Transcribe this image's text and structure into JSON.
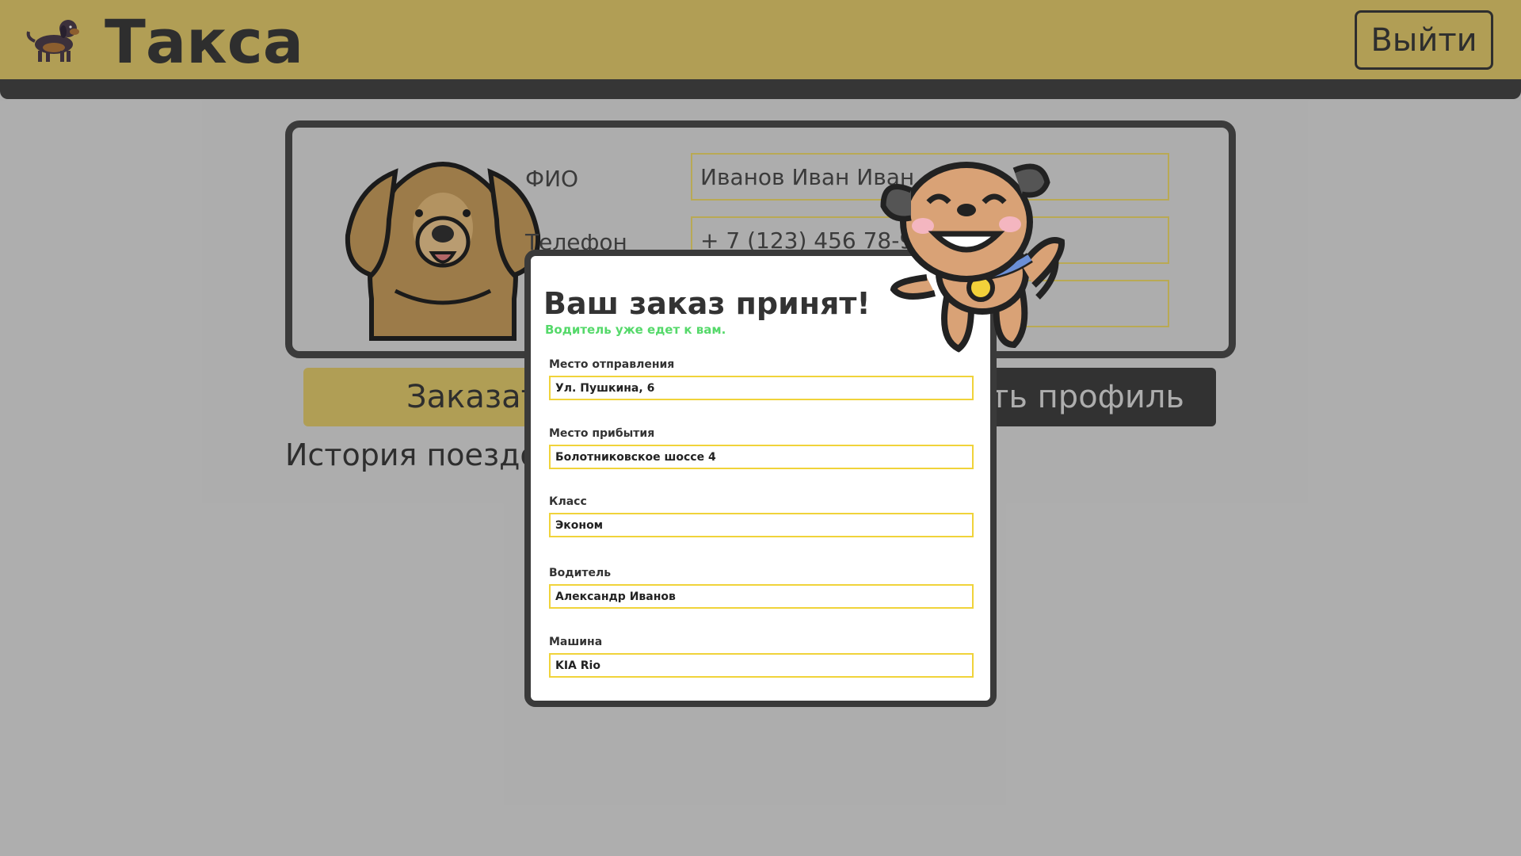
{
  "header": {
    "brand": "Такса",
    "logout_label": "Выйти"
  },
  "profile": {
    "fio_label": "ФИО",
    "fio_value": "Иванов Иван Иван",
    "phone_label": "Телефон",
    "phone_value": "+ 7 (123) 456 78-90",
    "third_value": ""
  },
  "actions": {
    "order_label": "Заказат",
    "edit_label": "ать профиль"
  },
  "history": {
    "title": "История поездо"
  },
  "modal": {
    "title": "Ваш заказ принят!",
    "subtitle": "Водитель уже едет к вам.",
    "fields": [
      {
        "label": "Место отправления",
        "value": "Ул. Пушкина, 6"
      },
      {
        "label": "Место прибытия",
        "value": "Болотниковское шоссе 4"
      },
      {
        "label": "Класс",
        "value": "Эконом"
      },
      {
        "label": "Водитель",
        "value": "Александр Иванов"
      },
      {
        "label": "Машина",
        "value": "KIA Rio"
      }
    ]
  },
  "colors": {
    "header": "#dec66b",
    "accent_yellow": "#f0d33a",
    "success_green": "#55d96a",
    "dark": "#3a3a3a"
  }
}
